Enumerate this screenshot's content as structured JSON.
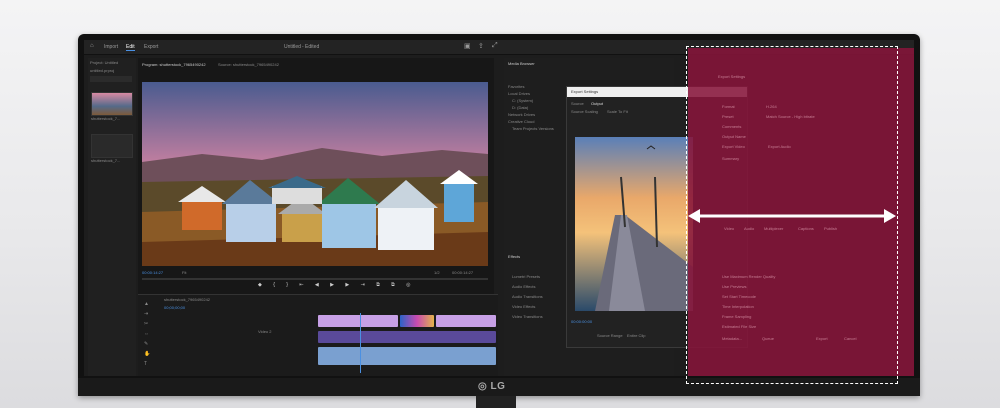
{
  "topbar": {
    "home": "⌂",
    "tabs": [
      "Import",
      "Edit",
      "Export"
    ],
    "title": "Untitled",
    "edited": "- Edited"
  },
  "project": {
    "header": "Project: Untitled",
    "search": "untitled.prproj",
    "items": [
      "shutterstock_7...",
      "shutterstock_7..."
    ]
  },
  "program": {
    "tab_left": "Program: shutterstock_7965490242",
    "tab_right": "Source: shutterstock_7965490242",
    "timecode_left": "00:00:14:27",
    "fit": "Fit",
    "fraction": "1/2",
    "timecode_right": "00:00:14:27"
  },
  "timeline": {
    "seq_name": "shutterstock_7965490242",
    "timecode": "00;00;00;00",
    "video_track": "Video 2"
  },
  "media_browser": {
    "title": "Media Browser",
    "items": [
      "Favorites",
      "Local Drives",
      "C: (System)",
      "D: (Data)",
      "Network Drives",
      "Creative Cloud",
      "Team Projects Versions"
    ]
  },
  "effects": {
    "title": "Effects",
    "items": [
      "Lumetri Presets",
      "Audio Effects",
      "Audio Transitions",
      "Video Effects",
      "Video Transitions"
    ]
  },
  "dialog": {
    "title": "Export Settings",
    "tabs": [
      "Source",
      "Output"
    ],
    "scaling": "Source Scaling",
    "scaling_value": "Scale To Fit",
    "timecode": "00:00:00:00",
    "range": "Source Range",
    "range_value": "Entire Clip"
  },
  "overlay": {
    "labels": [
      "Export Settings",
      "Format",
      "H.264",
      "Preset",
      "Match Source - High bitrate",
      "Comments",
      "Output Name",
      "Export Video",
      "Export Audio",
      "Summary",
      "Video",
      "Audio",
      "Multiplexer",
      "Captions",
      "Publish",
      "Use Maximum Render Quality",
      "Use Previews",
      "Set Start Timecode",
      "Time Interpolation",
      "Frame Sampling",
      "Estimated File Size",
      "Metadata...",
      "Queue",
      "Export",
      "Cancel"
    ]
  }
}
